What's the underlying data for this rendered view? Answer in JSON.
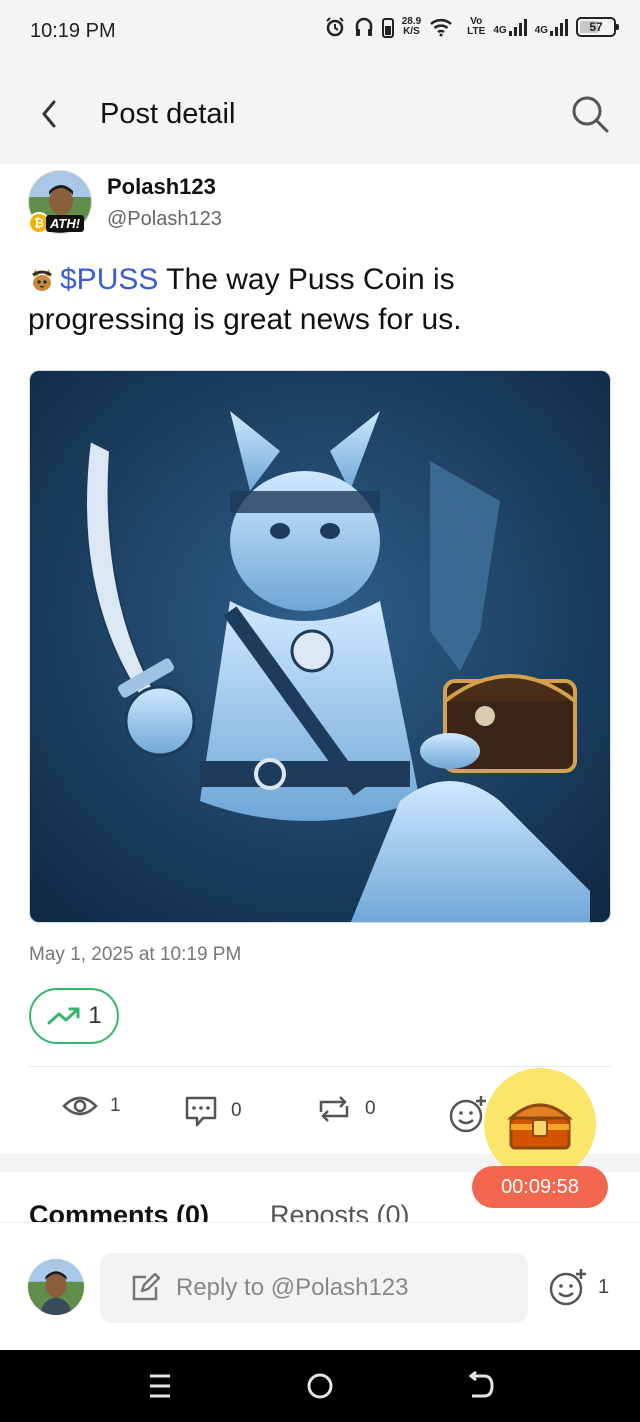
{
  "status_bar": {
    "time": "10:19 PM",
    "net_speed_value": "28.9",
    "net_speed_unit": "K/S",
    "volte_top": "Vo",
    "volte_bottom": "LTE",
    "sim1_label": "4G",
    "sim2_label": "4G",
    "battery": "57"
  },
  "header": {
    "title": "Post detail"
  },
  "post": {
    "author_name": "Polash123",
    "author_handle": "@Polash123",
    "badge_label": "ATH!",
    "ticker": "$PUSS",
    "text": " The way Puss Coin is progressing is great news for us.",
    "date": "May 1, 2025 at 10:19 PM",
    "trend_count": "1",
    "views": "1",
    "comments": "0",
    "reposts": "0"
  },
  "floating": {
    "timer": "00:09:58"
  },
  "tabs": [
    {
      "label": "Comments (0)",
      "active": true
    },
    {
      "label": "Reposts (0)",
      "active": false
    }
  ],
  "reply": {
    "placeholder": "Reply to @Polash123",
    "reaction_count": "1"
  },
  "colors": {
    "accent_link": "#3b5bdb",
    "trend_green": "#34b66f",
    "timer_red": "#f2674e",
    "fab_yellow": "#fbe56a"
  }
}
